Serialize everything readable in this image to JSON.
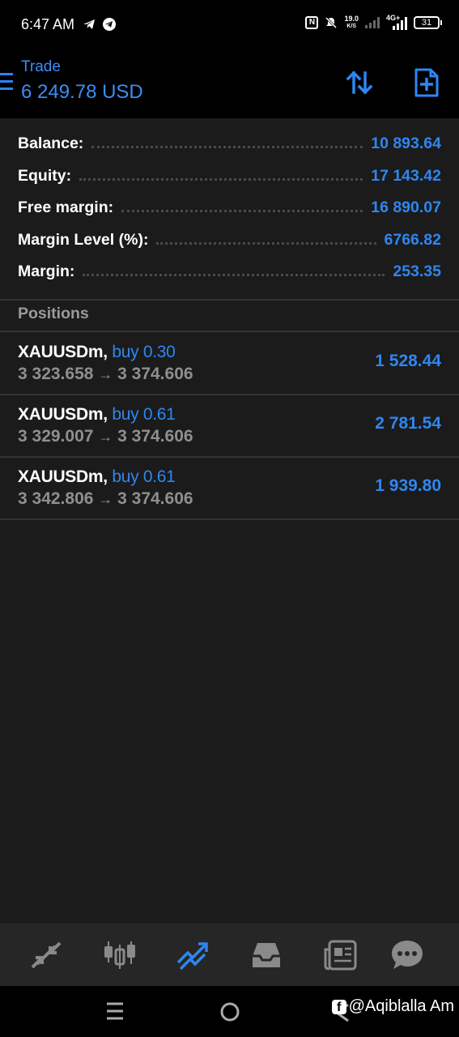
{
  "status_bar": {
    "time": "6:47 AM",
    "speed_value": "19.0",
    "speed_unit": "K/S",
    "network": "4G+",
    "battery": "31"
  },
  "header": {
    "title": "Trade",
    "amount": "6 249.78 USD",
    "icons": [
      "menu-icon",
      "sort-icon",
      "new-order-icon"
    ]
  },
  "account": {
    "rows": [
      {
        "label": "Balance:",
        "value": "10 893.64"
      },
      {
        "label": "Equity:",
        "value": "17 143.42"
      },
      {
        "label": "Free margin:",
        "value": "16 890.07"
      },
      {
        "label": "Margin Level (%):",
        "value": "6766.82"
      },
      {
        "label": "Margin:",
        "value": "253.35"
      }
    ]
  },
  "positions": {
    "header": "Positions",
    "items": [
      {
        "symbol": "XAUUSDm,",
        "side": "buy 0.30",
        "open_price": "3 323.658",
        "arrow": "→",
        "current_price": "3 374.606",
        "profit": "1 528.44"
      },
      {
        "symbol": "XAUUSDm,",
        "side": "buy 0.61",
        "open_price": "3 329.007",
        "arrow": "→",
        "current_price": "3 374.606",
        "profit": "2 781.54"
      },
      {
        "symbol": "XAUUSDm,",
        "side": "buy 0.61",
        "open_price": "3 342.806",
        "arrow": "→",
        "current_price": "3 374.606",
        "profit": "1 939.80"
      }
    ]
  },
  "bottom_nav": {
    "items": [
      "quotes-icon",
      "chart-icon",
      "trade-icon",
      "history-icon",
      "news-icon",
      "chat-icon"
    ],
    "active": "trade-icon"
  },
  "watermark": {
    "text": "@Aqiblalla Am"
  },
  "colors": {
    "accent": "#2e86f0",
    "background": "#1b1b1b",
    "header": "#000000",
    "nav": "#262626"
  }
}
